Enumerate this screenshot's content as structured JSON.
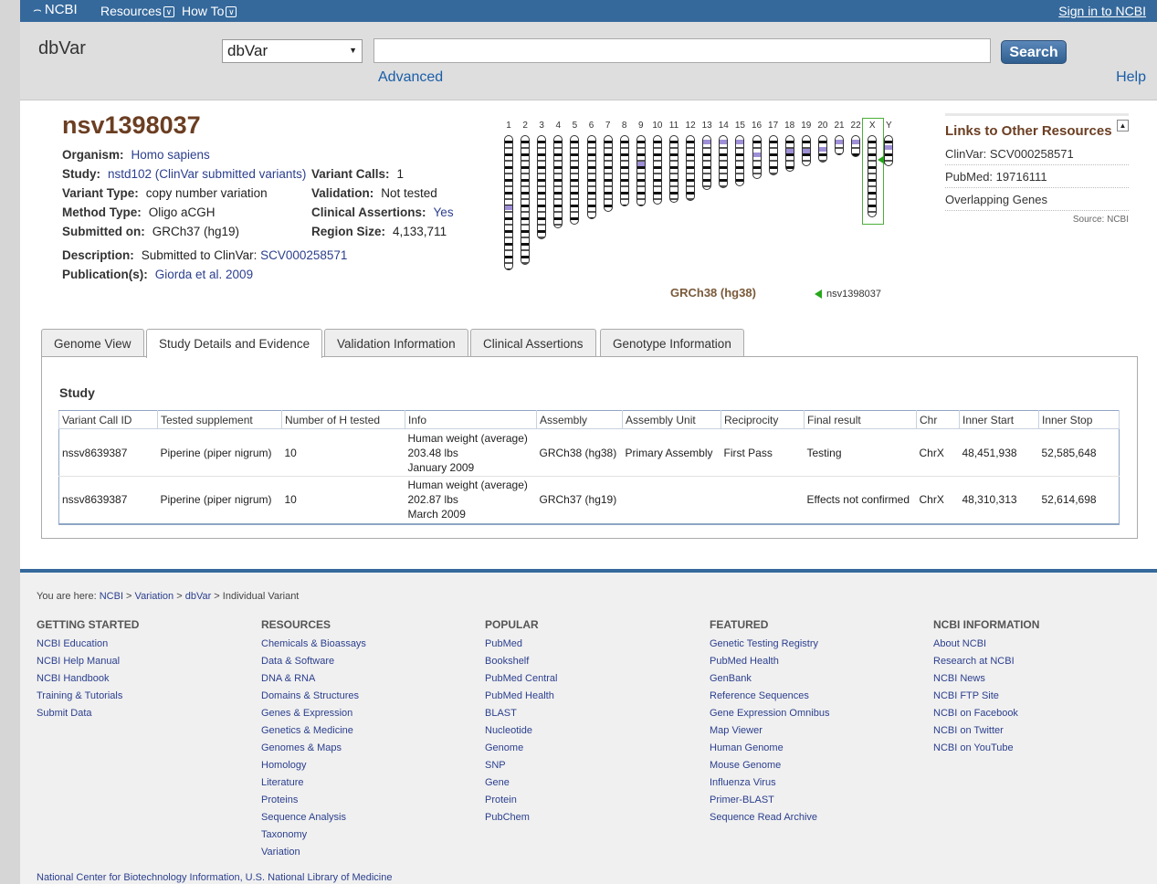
{
  "topbar": {
    "logo": "NCBI",
    "nav": [
      "Resources",
      "How To"
    ],
    "signin": "Sign in to NCBI"
  },
  "search": {
    "db_title": "dbVar",
    "db_selected": "dbVar",
    "query": "",
    "button": "Search",
    "advanced": "Advanced",
    "help": "Help"
  },
  "summary": {
    "accession": "nsv1398037",
    "organism_label": "Organism:",
    "organism": "Homo sapiens",
    "study_label": "Study:",
    "study": "nstd102 (ClinVar submitted variants)",
    "variant_type_label": "Variant Type:",
    "variant_type": "copy number variation",
    "method_type_label": "Method Type:",
    "method_type": "Oligo aCGH",
    "submitted_on_label": "Submitted on:",
    "submitted_on": "GRCh37 (hg19)",
    "variant_calls_label": "Variant Calls:",
    "variant_calls": "1",
    "validation_label": "Validation:",
    "validation": "Not tested",
    "clinical_label": "Clinical Assertions:",
    "clinical": "Yes",
    "region_size_label": "Region Size:",
    "region_size": "4,133,711",
    "description_label": "Description:",
    "description_prefix": "Submitted to ClinVar:",
    "description_link": "SCV000258571",
    "publications_label": "Publication(s):",
    "publication": "Giorda et al. 2009"
  },
  "ideogram": {
    "chromosomes": [
      "1",
      "2",
      "3",
      "4",
      "5",
      "6",
      "7",
      "8",
      "9",
      "10",
      "11",
      "12",
      "13",
      "14",
      "15",
      "16",
      "17",
      "18",
      "19",
      "20",
      "21",
      "22",
      "X",
      "Y"
    ],
    "highlighted": "X",
    "assembly": "GRCh38 (hg38)",
    "legend": "nsv1398037"
  },
  "links": {
    "title": "Links to Other Resources",
    "toggle": "▲",
    "rows": [
      "ClinVar: SCV000258571",
      "PubMed: 19716111",
      "Overlapping Genes"
    ],
    "source": "Source: NCBI"
  },
  "tabs": [
    "Genome View",
    "Study Details and Evidence",
    "Validation Information",
    "Clinical Assertions",
    "Genotype Information"
  ],
  "study": {
    "heading": "Study",
    "columns": [
      "Variant Call ID",
      "Tested supplement",
      "Number of H tested",
      "Info",
      "Assembly",
      "Assembly Unit",
      "Reciprocity",
      "Final result",
      "Chr",
      "Inner Start",
      "Inner Stop"
    ],
    "rows": [
      {
        "id": "nssv8639387",
        "supplement": "Piperine (piper nigrum)",
        "n": "10",
        "info": [
          "Human weight (average)",
          "203.48 lbs",
          "January 2009"
        ],
        "assembly": "GRCh38 (hg38)",
        "unit": "Primary Assembly",
        "reciprocity": "First Pass",
        "result": "Testing",
        "chr": "ChrX",
        "start": "48,451,938",
        "stop": "52,585,648"
      },
      {
        "id": "nssv8639387",
        "supplement": "Piperine (piper nigrum)",
        "n": "10",
        "info": [
          "Human weight (average)",
          "202.87 lbs",
          "March 2009"
        ],
        "assembly": "GRCh37 (hg19)",
        "unit": "",
        "reciprocity": "",
        "result": "Effects not confirmed",
        "chr": "ChrX",
        "start": "48,310,313",
        "stop": "52,614,698"
      }
    ]
  },
  "footer": {
    "breadcrumb_prefix": "You are here:",
    "breadcrumb": [
      "NCBI",
      "Variation",
      "dbVar",
      "Individual Variant"
    ],
    "columns": [
      {
        "title": "GETTING STARTED",
        "items": [
          "NCBI Education",
          "NCBI Help Manual",
          "NCBI Handbook",
          "Training & Tutorials",
          "Submit Data"
        ]
      },
      {
        "title": "RESOURCES",
        "items": [
          "Chemicals & Bioassays",
          "Data & Software",
          "DNA & RNA",
          "Domains & Structures",
          "Genes & Expression",
          "Genetics & Medicine",
          "Genomes & Maps",
          "Homology",
          "Literature",
          "Proteins",
          "Sequence Analysis",
          "Taxonomy",
          "Variation"
        ]
      },
      {
        "title": "POPULAR",
        "items": [
          "PubMed",
          "Bookshelf",
          "PubMed Central",
          "PubMed Health",
          "BLAST",
          "Nucleotide",
          "Genome",
          "SNP",
          "Gene",
          "Protein",
          "PubChem"
        ]
      },
      {
        "title": "FEATURED",
        "items": [
          "Genetic Testing Registry",
          "PubMed Health",
          "GenBank",
          "Reference Sequences",
          "Gene Expression Omnibus",
          "Map Viewer",
          "Human Genome",
          "Mouse Genome",
          "Influenza Virus",
          "Primer-BLAST",
          "Sequence Read Archive"
        ]
      },
      {
        "title": "NCBI INFORMATION",
        "items": [
          "About NCBI",
          "Research at NCBI",
          "NCBI News",
          "NCBI FTP Site",
          "NCBI on Facebook",
          "NCBI on Twitter",
          "NCBI on YouTube"
        ]
      }
    ],
    "nlm": "National Center for Biotechnology Information, U.S. National Library of Medicine"
  }
}
